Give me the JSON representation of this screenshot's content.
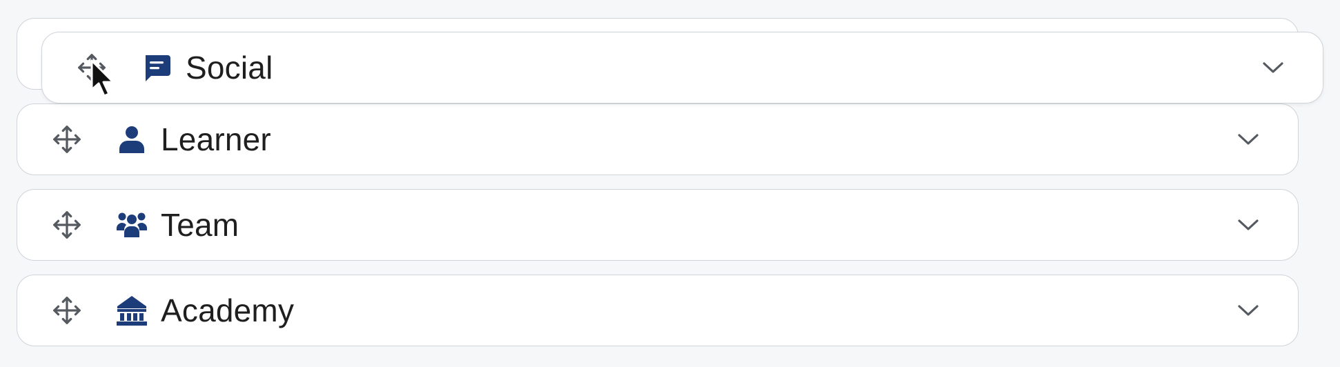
{
  "list": {
    "items": [
      {
        "label": "Social",
        "icon": "message-icon",
        "state": "dragging"
      },
      {
        "label": "Learner",
        "icon": "person-icon"
      },
      {
        "label": "Team",
        "icon": "team-icon"
      },
      {
        "label": "Academy",
        "icon": "building-icon"
      }
    ]
  },
  "colors": {
    "icon_accent": "#1d3d7a",
    "handle": "#555a61",
    "border": "#cfd3da",
    "text": "#1f1f1f"
  }
}
